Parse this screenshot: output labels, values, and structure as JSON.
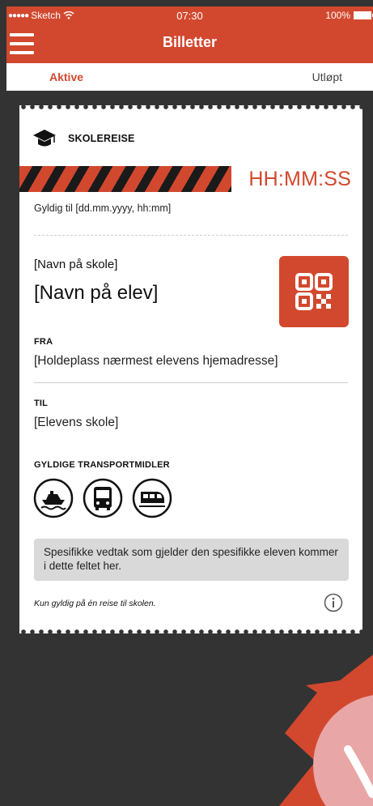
{
  "status_bar": {
    "carrier": "Sketch",
    "time": "07:30",
    "battery": "100%"
  },
  "header": {
    "title": "Billetter"
  },
  "tabs": [
    {
      "label": "Aktive",
      "active": true
    },
    {
      "label": "Utløpt",
      "active": false
    }
  ],
  "ticket": {
    "type_label": "SKOLEREISE",
    "type_icon": "graduation-cap-icon",
    "timer": "HH:MM:SS",
    "valid_until": "Gyldig til [dd.mm.yyyy, hh:mm]",
    "school_name": "[Navn på skole]",
    "student_name": "[Navn på elev]",
    "qr_icon": "qr-code-icon",
    "from_label": "FRA",
    "from_value": "[Holdeplass nærmest elevens hjemadresse]",
    "to_label": "TIL",
    "to_value": "[Elevens skole]",
    "transport_label": "GYLDIGE TRANSPORTMIDLER",
    "transport_modes": [
      "boat-icon",
      "bus-icon",
      "train-icon"
    ],
    "notice": "Spesifikke vedtak som gjelder den spesifikke eleven kommer i dette feltet her.",
    "footer_note": "Kun gyldig på én reise til skolen.",
    "info_icon": "info-icon"
  },
  "colors": {
    "accent": "#d2482e",
    "background": "#333333",
    "card": "#ffffff",
    "notice_bg": "#d9d9d9"
  }
}
